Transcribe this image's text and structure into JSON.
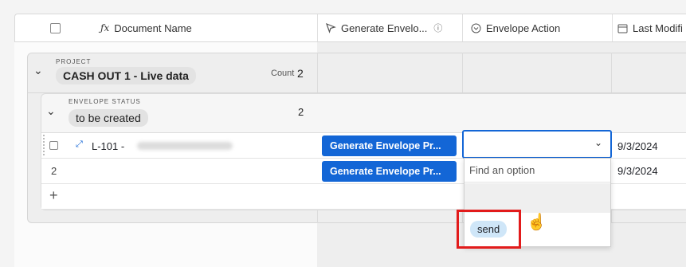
{
  "header": {
    "doc_name": "Document Name",
    "generate": "Generate Envelo...",
    "envelope_action": "Envelope Action",
    "last_modified": "Last Modifi"
  },
  "group_project": {
    "label": "PROJECT",
    "name": "CASH OUT 1 - Live data",
    "count_label": "Count",
    "count": "2"
  },
  "group_status": {
    "label": "ENVELOPE STATUS",
    "name": "to be created",
    "count": "2"
  },
  "rows": [
    {
      "number": "",
      "doc_name": "L-101 -",
      "button": "Generate Envelope Pr...",
      "date": "9/3/2024"
    },
    {
      "number": "2",
      "doc_name": "",
      "button": "Generate Envelope Pr...",
      "date": "9/3/2024"
    }
  ],
  "add_row": "+",
  "dropdown": {
    "search_placeholder": "Find an option",
    "option": "send"
  },
  "colors": {
    "accent": "#1366d6",
    "highlight": "#e21b1b",
    "option_pill": "#cfe6f8"
  }
}
